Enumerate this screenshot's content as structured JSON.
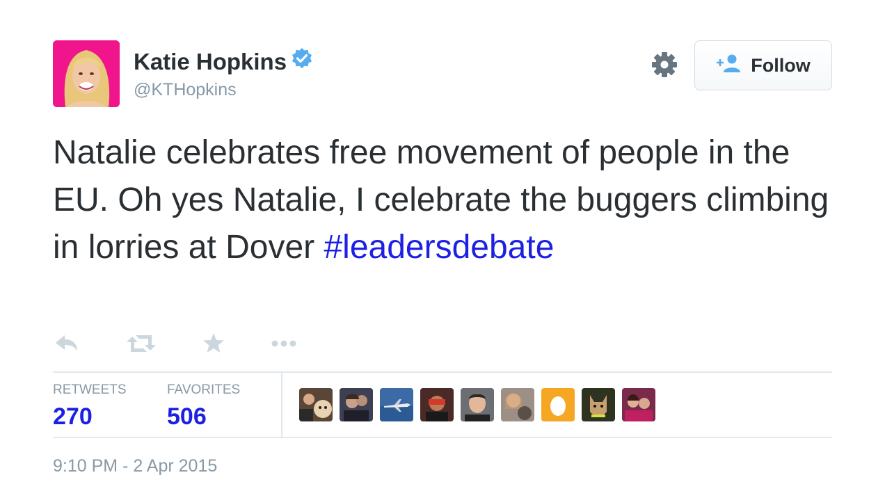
{
  "user": {
    "name": "Katie Hopkins",
    "handle": "@KTHopkins"
  },
  "follow_button": {
    "label": "Follow"
  },
  "tweet": {
    "text": "Natalie celebrates free movement of people in the EU. Oh yes Natalie, I celebrate the buggers climbing in lorries at Dover ",
    "hashtag": "#leadersdebate"
  },
  "actions": [
    {
      "icon": "reply-icon"
    },
    {
      "icon": "retweet-icon"
    },
    {
      "icon": "star-icon"
    },
    {
      "icon": "more-icon"
    }
  ],
  "stats": {
    "retweets_label": "RETWEETS",
    "retweets_count": "270",
    "favorites_label": "FAVORITES",
    "favorites_count": "506"
  },
  "favorited_by": [
    {
      "icon": "avatar-couple-with-dog",
      "color": "#5a4636"
    },
    {
      "icon": "avatar-two-people",
      "color": "#3d3f52"
    },
    {
      "icon": "avatar-jet-plane",
      "color": "#3b6aa6"
    },
    {
      "icon": "avatar-person-red",
      "color": "#4a2a26"
    },
    {
      "icon": "avatar-man-portrait",
      "color": "#6b6e72"
    },
    {
      "icon": "avatar-woman-with-cat",
      "color": "#9c8f86"
    },
    {
      "icon": "avatar-default-egg",
      "color": "#f5a623"
    },
    {
      "icon": "avatar-dog",
      "color": "#2e3320"
    },
    {
      "icon": "avatar-two-women",
      "color": "#7a2a4a"
    }
  ],
  "timestamp": "9:10 PM - 2 Apr 2015",
  "colors": {
    "link": "#1b20e3",
    "text": "#292f33",
    "muted": "#8899a6",
    "verified": "#55acee",
    "avatar_bg": "#f0158c"
  }
}
